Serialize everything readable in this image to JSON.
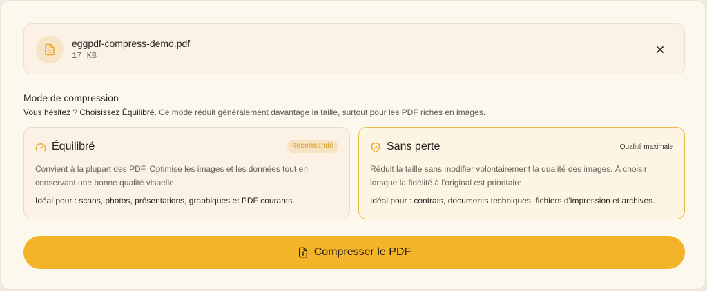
{
  "file": {
    "name": "eggpdf-compress-demo.pdf",
    "size": "17 KB",
    "icon": "pdf-file-icon",
    "close_icon": "close-icon"
  },
  "compression": {
    "title": "Mode de compression",
    "hint_strong": "Vous hésitez ? Choisissez Équilibré.",
    "hint_rest": " Ce mode réduit généralement davantage la taille, surtout pour les PDF riches en images.",
    "modes": [
      {
        "id": "balanced",
        "icon": "gauge-icon",
        "title": "Équilibré",
        "badge": "Recommandé",
        "description": "Convient à la plupart des PDF. Optimise les images et les données tout en conservant une bonne qualité visuelle.",
        "ideal": "Idéal pour : scans, photos, présentations, graphiques et PDF courants.",
        "selected": false
      },
      {
        "id": "lossless",
        "icon": "shield-check-icon",
        "title": "Sans perte",
        "badge": "Qualité maximale",
        "description": "Réduit la taille sans modifier volontairement la qualité des images. À choisir lorsque la fidélité à l'original est prioritaire.",
        "ideal": "Idéal pour : contrats, documents techniques, fichiers d'impression et archives.",
        "selected": true
      }
    ]
  },
  "action": {
    "label": "Compresser le PDF",
    "icon": "compress-file-icon"
  },
  "colors": {
    "accent": "#f3b42a",
    "badge_text": "#d59a25",
    "selected_border": "#e7bb49"
  }
}
